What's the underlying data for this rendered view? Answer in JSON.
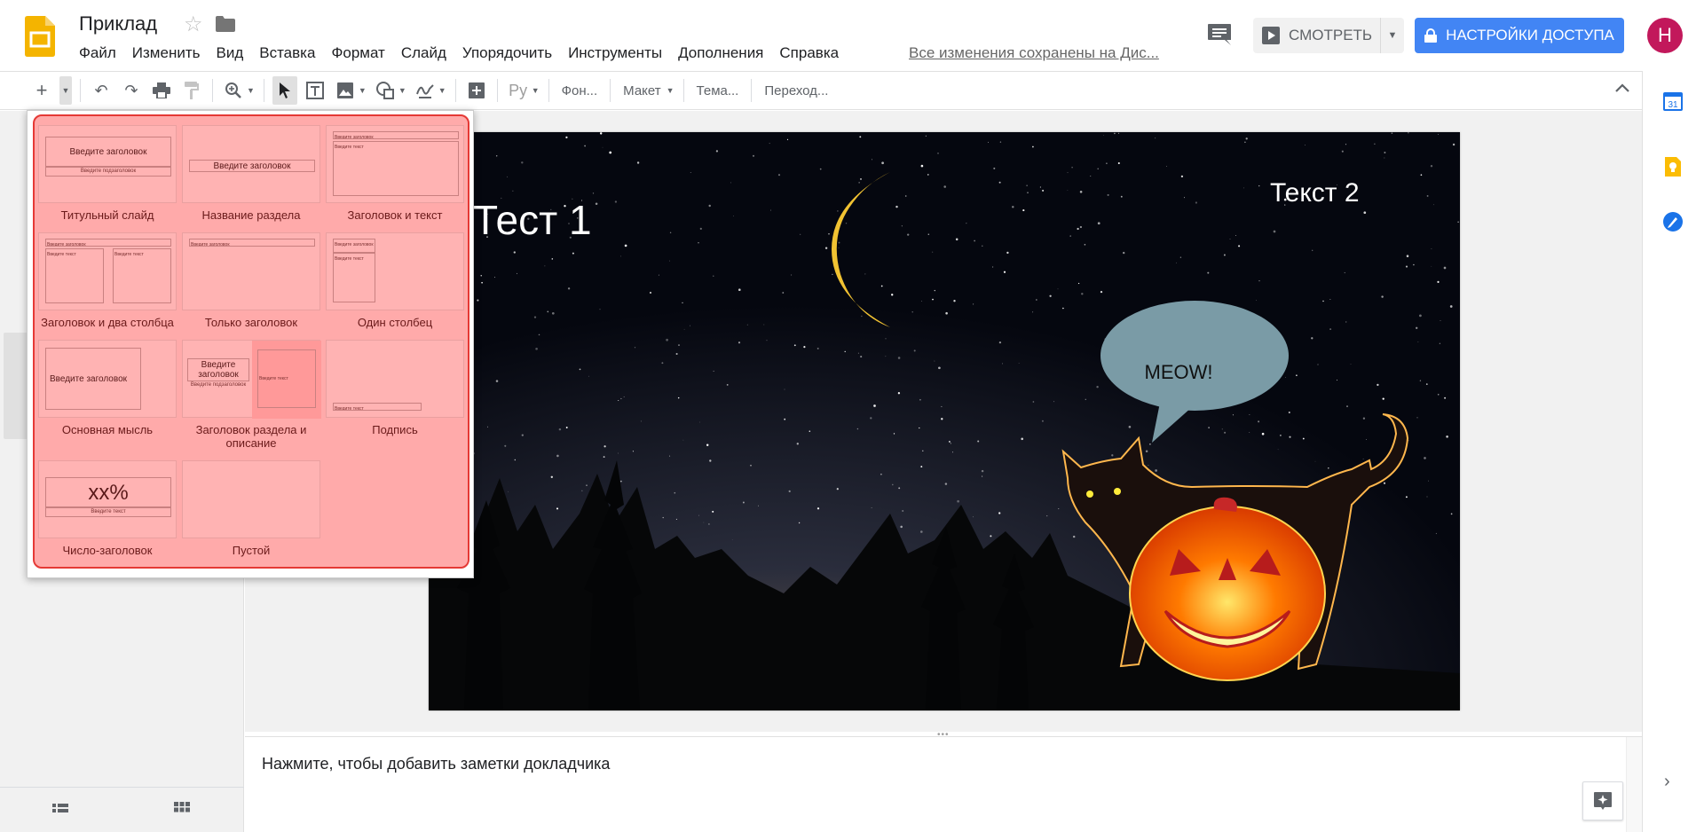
{
  "app": {
    "title": "Приклад",
    "save_status": "Все изменения сохранены на Дис..."
  },
  "menu": {
    "items": [
      "Файл",
      "Изменить",
      "Вид",
      "Вставка",
      "Формат",
      "Слайд",
      "Упорядочить",
      "Инструменты",
      "Дополнения",
      "Справка"
    ]
  },
  "header": {
    "present_label": "СМОТРЕТЬ",
    "share_label": "НАСТРОЙКИ ДОСТУПА",
    "avatar_letter": "Н"
  },
  "toolbar": {
    "font_label": "Ру",
    "background_label": "Фон...",
    "layout_label": "Макет",
    "theme_label": "Тема...",
    "transition_label": "Переход..."
  },
  "layouts": {
    "items": [
      {
        "label": "Титульный слайд",
        "ph_title": "Введите заголовок",
        "ph_sub": "Введите подзаголовок"
      },
      {
        "label": "Название раздела",
        "ph_title": "Введите заголовок"
      },
      {
        "label": "Заголовок и текст",
        "ph_title": "Введите заголовок",
        "ph_body": "Введите текст"
      },
      {
        "label": "Заголовок и два столбца",
        "ph_title": "Введите заголовок",
        "ph_body": "Введите текст"
      },
      {
        "label": "Только заголовок",
        "ph_title": "Введите заголовок"
      },
      {
        "label": "Один столбец",
        "ph_title": "Введите заголовок",
        "ph_body": "Введите текст"
      },
      {
        "label": "Основная мысль",
        "ph_title": "Введите заголовок"
      },
      {
        "label": "Заголовок раздела и описание",
        "ph_title": "Введите заголовок",
        "ph_sub": "Введите подзаголовок",
        "ph_body": "Введите текст"
      },
      {
        "label": "Подпись",
        "ph_body": "Введите текст"
      },
      {
        "label": "Число-заголовок",
        "ph_title": "xx%",
        "ph_body": "Введите текст"
      },
      {
        "label": "Пустой"
      }
    ]
  },
  "slide": {
    "text1": "Тест 1",
    "text2": "Текст 2",
    "speech": "MEOW!"
  },
  "notes": {
    "placeholder": "Нажмите, чтобы добавить заметки докладчика"
  },
  "side_panel": {
    "calendar_day": "31"
  },
  "colors": {
    "accent": "#4285f4",
    "avatar": "#c2185b",
    "layout_highlight": "#ffaaaa",
    "layout_highlight_border": "#e53935",
    "slides_brand": "#f4b400"
  }
}
